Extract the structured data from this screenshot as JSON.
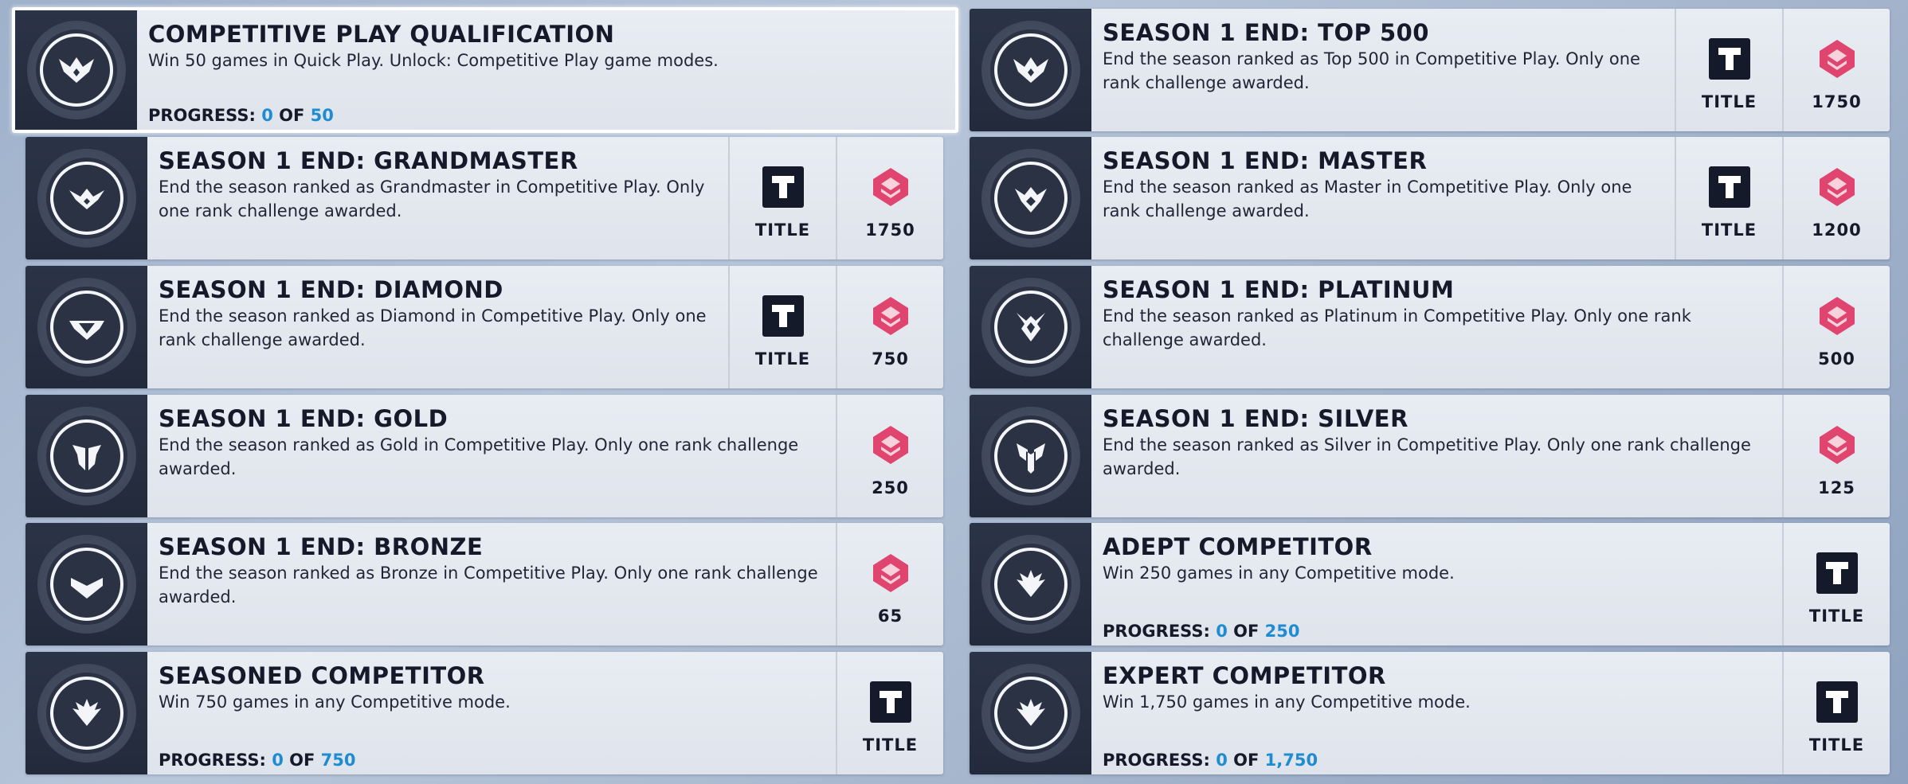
{
  "colors": {
    "progress_accent": "#1f8bd1",
    "currency_pink": "#e0456f",
    "title_icon_bg": "#151a2a"
  },
  "challenges": [
    {
      "title": "COMPETITIVE PLAY QUALIFICATION",
      "desc": "Win 50 games in Quick Play. Unlock: Competitive Play game modes.",
      "progress_label": "PROGRESS:",
      "progress_current": "0",
      "progress_of": "OF",
      "progress_total": "50",
      "selected": true
    },
    {
      "title": "SEASON 1 END: TOP 500",
      "desc": "End the season ranked as Top 500 in Competitive Play. Only one rank challenge awarded.",
      "reward_title": "TITLE",
      "reward_currency": "1750"
    },
    {
      "title": "SEASON 1 END: GRANDMASTER",
      "desc": "End the season ranked as Grandmaster in Competitive Play. Only one rank challenge awarded.",
      "reward_title": "TITLE",
      "reward_currency": "1750"
    },
    {
      "title": "SEASON 1 END: MASTER",
      "desc": "End the season ranked as Master in Competitive Play. Only one rank challenge awarded.",
      "reward_title": "TITLE",
      "reward_currency": "1200"
    },
    {
      "title": "SEASON 1 END: DIAMOND",
      "desc": "End the season ranked as Diamond in Competitive Play. Only one rank challenge awarded.",
      "reward_title": "TITLE",
      "reward_currency": "750"
    },
    {
      "title": "SEASON 1 END: PLATINUM",
      "desc": "End the season ranked as Platinum in Competitive Play. Only one rank challenge awarded.",
      "reward_currency": "500"
    },
    {
      "title": "SEASON 1 END: GOLD",
      "desc": "End the season ranked as Gold in Competitive Play. Only one rank challenge awarded.",
      "reward_currency": "250"
    },
    {
      "title": "SEASON 1 END: SILVER",
      "desc": "End the season ranked as Silver in Competitive Play. Only one rank challenge awarded.",
      "reward_currency": "125"
    },
    {
      "title": "SEASON 1 END: BRONZE",
      "desc": "End the season ranked as Bronze in Competitive Play. Only one rank challenge awarded.",
      "reward_currency": "65"
    },
    {
      "title": "ADEPT COMPETITOR",
      "desc": "Win 250 games in any Competitive mode.",
      "progress_label": "PROGRESS:",
      "progress_current": "0",
      "progress_of": "OF",
      "progress_total": "250",
      "reward_title": "TITLE"
    },
    {
      "title": "SEASONED COMPETITOR",
      "desc": "Win 750 games in any Competitive mode.",
      "progress_label": "PROGRESS:",
      "progress_current": "0",
      "progress_of": "OF",
      "progress_total": "750",
      "reward_title": "TITLE"
    },
    {
      "title": "EXPERT COMPETITOR",
      "desc": "Win 1,750 games in any Competitive mode.",
      "progress_label": "PROGRESS:",
      "progress_current": "0",
      "progress_of": "OF",
      "progress_total": "1,750",
      "reward_title": "TITLE"
    }
  ]
}
